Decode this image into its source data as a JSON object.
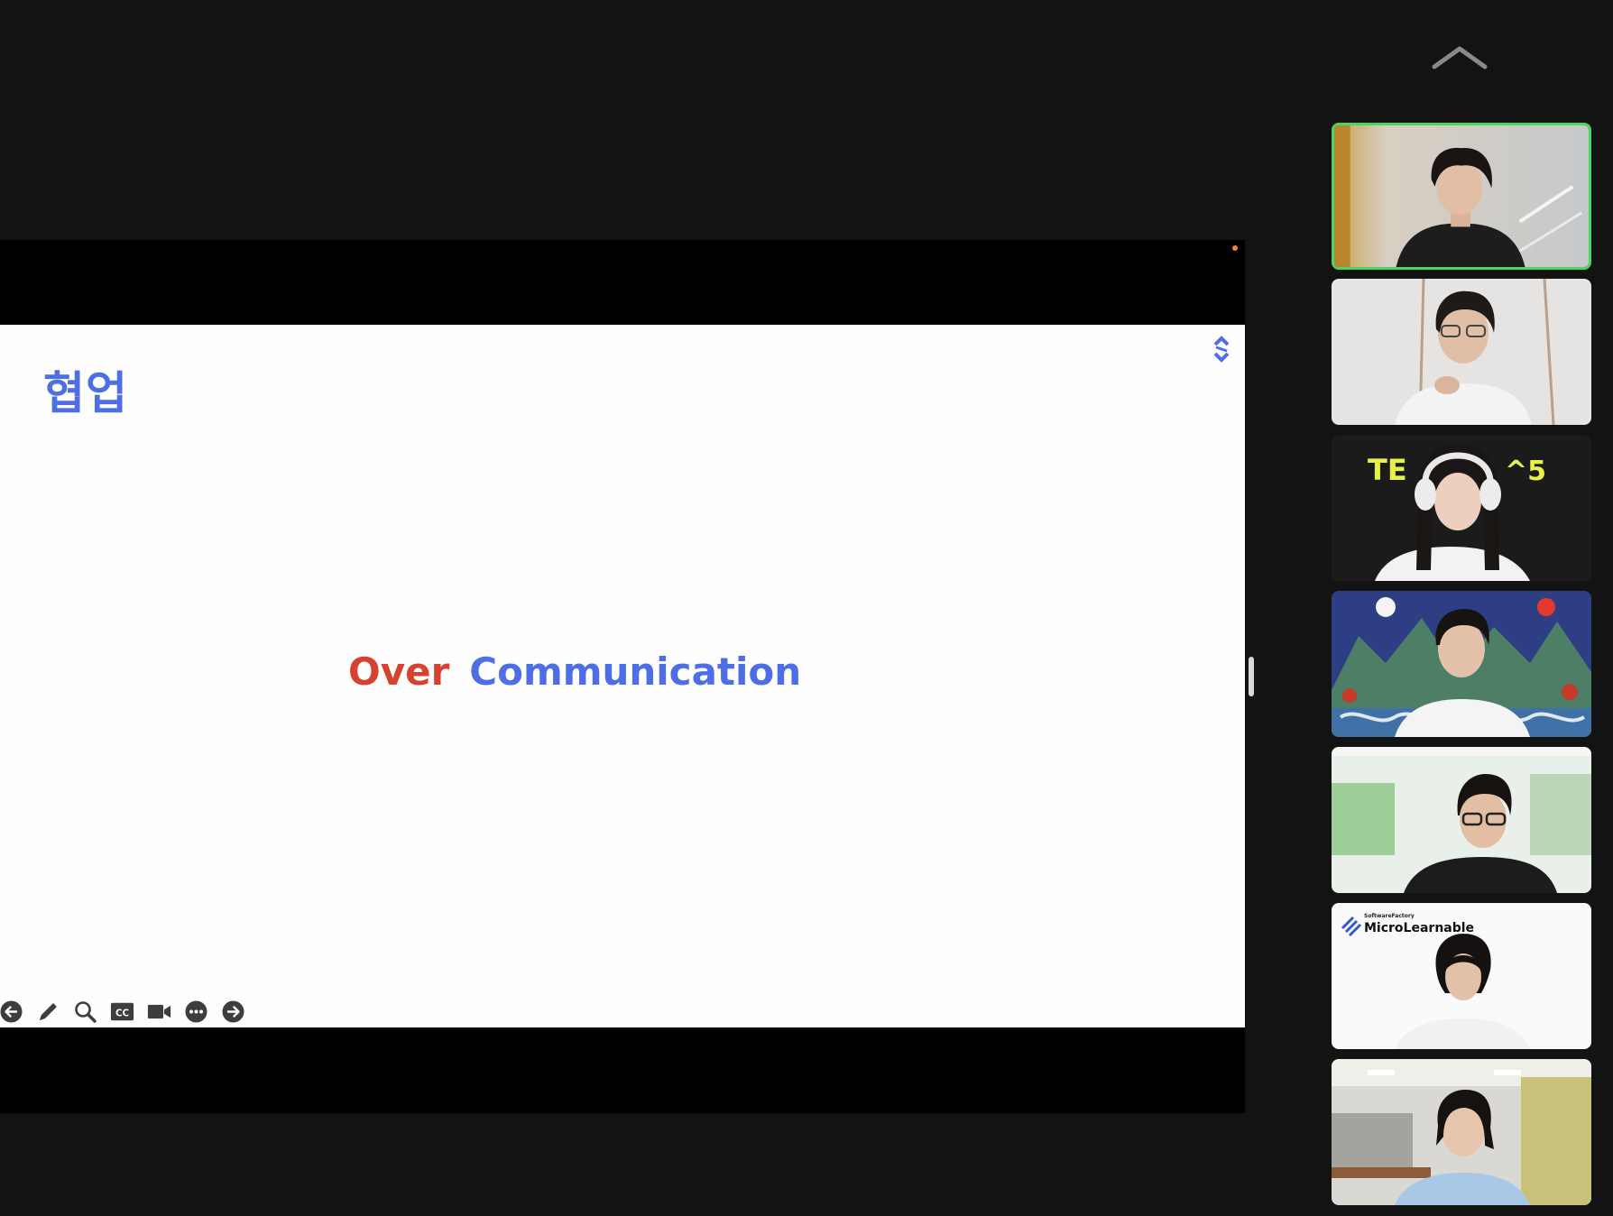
{
  "slide": {
    "title": "협업",
    "word_over": "Over",
    "word_communication": "Communication"
  },
  "colors": {
    "background": "#131313",
    "letterbox": "#000000",
    "slide_bg": "#fefefe",
    "blue": "#4e6ee6",
    "red": "#d8412f",
    "active_speaker_border": "#4cd45e"
  },
  "toolbar": {
    "buttons": [
      {
        "icon": "arrow-left-icon"
      },
      {
        "icon": "pen-icon"
      },
      {
        "icon": "magnifier-icon"
      },
      {
        "icon": "closed-captions-icon"
      },
      {
        "icon": "video-camera-icon"
      },
      {
        "icon": "more-icon"
      },
      {
        "icon": "arrow-right-icon"
      }
    ]
  },
  "gallery": {
    "collapse_icon": "chevron-up-icon",
    "participants": [
      {
        "background": "office-hallway",
        "active": true
      },
      {
        "background": "white-room",
        "active": false
      },
      {
        "background": "dark-banner",
        "banner_text_left": "TE",
        "banner_text_right": "^5",
        "active": false
      },
      {
        "background": "korean-folding-screen",
        "active": false
      },
      {
        "background": "green-blurred-office",
        "active": false
      },
      {
        "background": "white-branding",
        "brand_small": "SoftwareFactory",
        "brand_large": "MicroLearnable",
        "active": false
      },
      {
        "background": "office-corridor",
        "active": false
      }
    ]
  }
}
